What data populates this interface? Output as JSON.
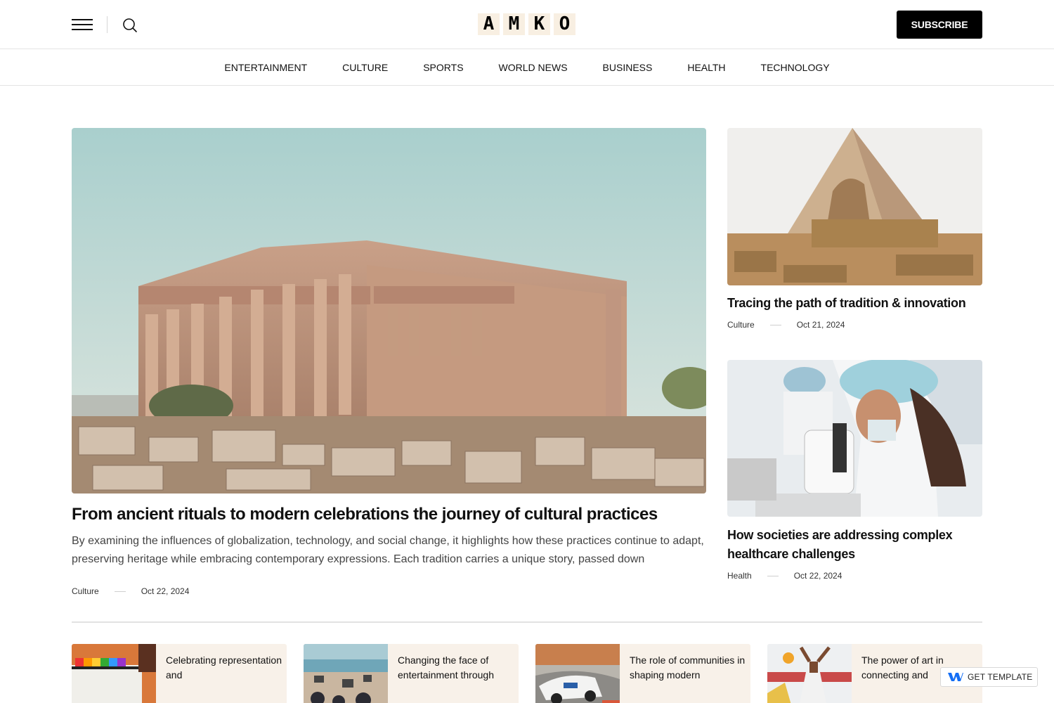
{
  "header": {
    "logo_letters": [
      "A",
      "M",
      "K",
      "O"
    ],
    "subscribe_label": "SUBSCRIBE",
    "menu_icon": "hamburger-menu-icon",
    "search_icon": "search-icon"
  },
  "nav": {
    "items": [
      {
        "label": "ENTERTAINMENT"
      },
      {
        "label": "CULTURE"
      },
      {
        "label": "SPORTS"
      },
      {
        "label": "WORLD NEWS"
      },
      {
        "label": "BUSINESS"
      },
      {
        "label": "HEALTH"
      },
      {
        "label": "TECHNOLOGY"
      }
    ]
  },
  "feature": {
    "title": "From ancient rituals to modern celebrations the journey of cultural practices",
    "excerpt": "By examining the influences of globalization, technology, and social change, it highlights how these practices continue to adapt, preserving heritage while embracing contemporary expressions. Each tradition carries a unique story, passed down",
    "category": "Culture",
    "date": "Oct 22, 2024"
  },
  "side": [
    {
      "title": "Tracing the path of tradition & innovation",
      "category": "Culture",
      "date": "Oct 21, 2024"
    },
    {
      "title": "How societies are addressing complex healthcare challenges",
      "category": "Health",
      "date": "Oct 22, 2024"
    }
  ],
  "mini": [
    {
      "title": "Celebrating representation and"
    },
    {
      "title": "Changing the face of entertainment through"
    },
    {
      "title": "The role of communities in shaping modern"
    },
    {
      "title": "The power of art in connecting and"
    }
  ],
  "badge": {
    "label": "GET TEMPLATE"
  },
  "colors": {
    "accent_black": "#000000",
    "logo_bg": "#f8efe2",
    "card_bg": "#f8f1e9",
    "badge_blue": "#146ef5"
  }
}
